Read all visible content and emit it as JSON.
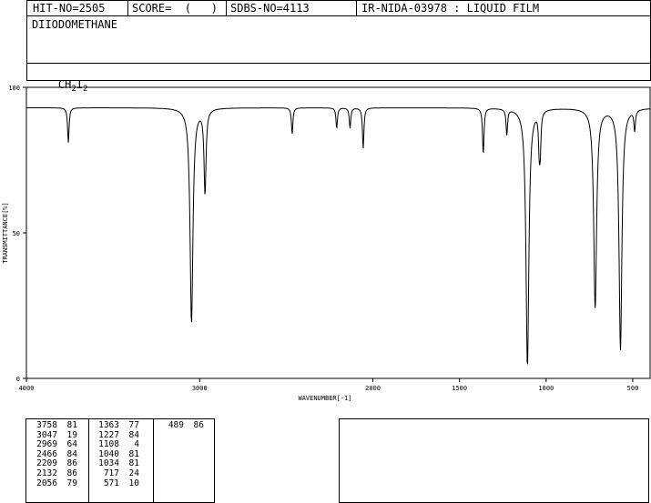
{
  "header": {
    "hit_no": "HIT-NO=2505",
    "score": "SCORE=  (   )",
    "sdbs_no": "SDBS-NO=4113",
    "ir_id": "IR-NIDA-03978 : LIQUID FILM",
    "compound_name": "DIIODOMETHANE",
    "formula_main": "CH",
    "formula_sub1": "2",
    "formula_mid": "I",
    "formula_sub2": "2"
  },
  "chart_data": {
    "type": "line",
    "title": "",
    "xlabel": "WAVENUMBER[-1]",
    "ylabel": "TRANSMITTANCE[%]",
    "xlim": [
      4000,
      400
    ],
    "ylim": [
      0,
      100
    ],
    "x_ticks": [
      4000,
      3000,
      2000,
      1500,
      1000,
      500
    ],
    "y_ticks": [
      0,
      50,
      100
    ],
    "baseline": 93,
    "peaks": [
      {
        "x": 3758,
        "y": 81
      },
      {
        "x": 3047,
        "y": 19
      },
      {
        "x": 2969,
        "y": 64
      },
      {
        "x": 2466,
        "y": 84
      },
      {
        "x": 2209,
        "y": 86
      },
      {
        "x": 2132,
        "y": 86
      },
      {
        "x": 2056,
        "y": 79
      },
      {
        "x": 1363,
        "y": 77
      },
      {
        "x": 1227,
        "y": 84
      },
      {
        "x": 1108,
        "y": 4
      },
      {
        "x": 1040,
        "y": 81
      },
      {
        "x": 1034,
        "y": 81
      },
      {
        "x": 717,
        "y": 24
      },
      {
        "x": 571,
        "y": 10
      },
      {
        "x": 489,
        "y": 86
      }
    ]
  },
  "peak_table": {
    "col1": [
      [
        "3758",
        "81"
      ],
      [
        "3047",
        "19"
      ],
      [
        "2969",
        "64"
      ],
      [
        "2466",
        "84"
      ],
      [
        "2209",
        "86"
      ],
      [
        "2132",
        "86"
      ],
      [
        "2056",
        "79"
      ]
    ],
    "col2": [
      [
        "1363",
        "77"
      ],
      [
        "1227",
        "84"
      ],
      [
        "1108",
        "4"
      ],
      [
        "1040",
        "81"
      ],
      [
        "1034",
        "81"
      ],
      [
        "717",
        "24"
      ],
      [
        "571",
        "10"
      ]
    ],
    "col3": [
      [
        "489",
        "86"
      ]
    ]
  }
}
